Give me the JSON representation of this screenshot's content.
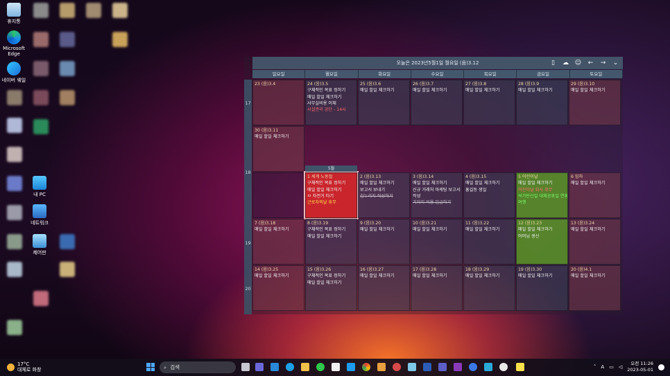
{
  "desktop": {
    "icons": [
      {
        "name": "recycle-bin",
        "label": "휴지통"
      },
      {
        "name": "microsoft-edge",
        "label": "Microsoft Edge"
      },
      {
        "name": "naver-whale",
        "label": "네이버 웨일"
      },
      {
        "name": "my-pc",
        "label": "내 PC"
      },
      {
        "name": "network",
        "label": "네트워크"
      },
      {
        "name": "control-panel",
        "label": "제어판"
      }
    ]
  },
  "calendar": {
    "title": "오늘은 2023년5월1일 월요일 (음)3.12",
    "day_headers": [
      "일요일",
      "월요일",
      "화요일",
      "수요일",
      "목요일",
      "금요일",
      "토요일"
    ],
    "week_numbers": [
      "17",
      "18",
      "19",
      "20"
    ],
    "month_tag": "5월",
    "rows": [
      [
        {
          "date": "23 (음)3.4",
          "items": []
        },
        {
          "date": "24 (음)3.5",
          "items": [
            {
              "text": "구체적인 목표 정하기"
            },
            {
              "text": "매일 할일 체크하기"
            },
            {
              "text": "사무실비용 이체"
            },
            {
              "text": "시설관리 공단 - 14시",
              "style": "red"
            }
          ]
        },
        {
          "date": "25 (음)3.6",
          "items": [
            {
              "text": "매일 할일 체크하기"
            }
          ]
        },
        {
          "date": "26 (음)3.7",
          "items": [
            {
              "text": "매일 할일 체크하기"
            }
          ]
        },
        {
          "date": "27 (음)3.8",
          "items": [
            {
              "text": "매일 할일 체크하기"
            }
          ]
        },
        {
          "date": "28 (음)3.9",
          "items": [
            {
              "text": "매일 할일 체크하기"
            }
          ]
        },
        {
          "date": "29 (음)3.10",
          "items": [
            {
              "text": "매일 할일 체크하기"
            }
          ]
        }
      ],
      [
        {
          "date": "30 (음)3.11",
          "items": [
            {
              "text": "매일 할일 체크하기"
            }
          ]
        }
      ],
      [
        {
          "date": "",
          "items": []
        },
        {
          "date": "1 세계 노동절",
          "items": [
            {
              "text": "구체적인 목표 정하기"
            },
            {
              "text": "매일 할일 체크하기"
            },
            {
              "text": "ㅁ 자전거 타기"
            },
            {
              "text": "근로자의날 휴무",
              "style": "yel"
            }
          ]
        },
        {
          "date": "2 (음)3.13",
          "items": [
            {
              "text": "매일 할일 체크하기"
            },
            {
              "text": "보고서 보내기"
            },
            {
              "text": "김누리지 작성하기",
              "style": "strike"
            }
          ]
        },
        {
          "date": "3 (음)3.14",
          "items": [
            {
              "text": "매일 할일 체크하기"
            },
            {
              "text": "신규 거래처 마케팅 보고서"
            },
            {
              "text": "작성"
            },
            {
              "text": "기자지 비용 입금하기",
              "style": "strike"
            }
          ]
        },
        {
          "date": "4 (음)3.15",
          "items": [
            {
              "text": "매일 할일 체크하기"
            },
            {
              "text": "홍길동 생일"
            }
          ]
        },
        {
          "date": "5 어린이날",
          "items": [
            {
              "text": "매일 할일 체크하기"
            },
            {
              "text": "어린이날 회사 휴무",
              "style": "red"
            },
            {
              "text": "석가탄신일 대체공휴일 연휴",
              "style": "grn"
            },
            {
              "text": "여행",
              "style": "grn"
            }
          ]
        },
        {
          "date": "6 입하",
          "items": [
            {
              "text": "매일 할일 체크하기"
            }
          ]
        }
      ],
      [
        {
          "date": "7 (음)3.18",
          "items": [
            {
              "text": "매일 할일 체크하기"
            }
          ]
        },
        {
          "date": "8 (음)3.19",
          "items": [
            {
              "text": "구체적인 목표 정하기"
            },
            {
              "text": "매일 할일 체크하기"
            }
          ]
        },
        {
          "date": "9 (음)3.20",
          "items": [
            {
              "text": "매일 할일 체크하기"
            }
          ]
        },
        {
          "date": "10 (음)3.21",
          "items": [
            {
              "text": "매일 할일 체크하기"
            }
          ]
        },
        {
          "date": "11 (음)3.22",
          "items": [
            {
              "text": "매일 할일 체크하기"
            }
          ]
        },
        {
          "date": "12 (음)3.23",
          "items": [
            {
              "text": "매일 할일 체크하기"
            },
            {
              "text": "어머님 생신"
            }
          ]
        },
        {
          "date": "13 (음)3.24",
          "items": [
            {
              "text": "매일 할일 체크하기"
            }
          ]
        }
      ],
      [
        {
          "date": "14 (음)3.25",
          "items": [
            {
              "text": "매일 할일 체크하기"
            }
          ]
        },
        {
          "date": "15 (음)3.26",
          "items": [
            {
              "text": "구체적인 목표 정하기"
            },
            {
              "text": "매일 할일 체크하기"
            }
          ]
        },
        {
          "date": "16 (음)3.27",
          "items": [
            {
              "text": "매일 할일 체크하기"
            }
          ]
        },
        {
          "date": "17 (음)3.28",
          "items": [
            {
              "text": "매일 할일 체크하기"
            }
          ]
        },
        {
          "date": "18 (음)3.29",
          "items": [
            {
              "text": "매일 할일 체크하기"
            }
          ]
        },
        {
          "date": "19 (음)3.30",
          "items": [
            {
              "text": "매일 할일 체크하기"
            }
          ]
        },
        {
          "date": "20 (음)4.1",
          "items": [
            {
              "text": "매일 할일 체크하기"
            }
          ]
        }
      ]
    ]
  },
  "taskbar": {
    "weather_temp": "17°C",
    "weather_desc": "대체로 화창",
    "search_label": "검색",
    "clock_time": "오전 11:26",
    "clock_date": "2023-05-01",
    "ime": "A"
  },
  "colors": {
    "selected_day": "#dc2828",
    "holiday_green": "#5a9628",
    "header_bar": "#465a6e"
  }
}
